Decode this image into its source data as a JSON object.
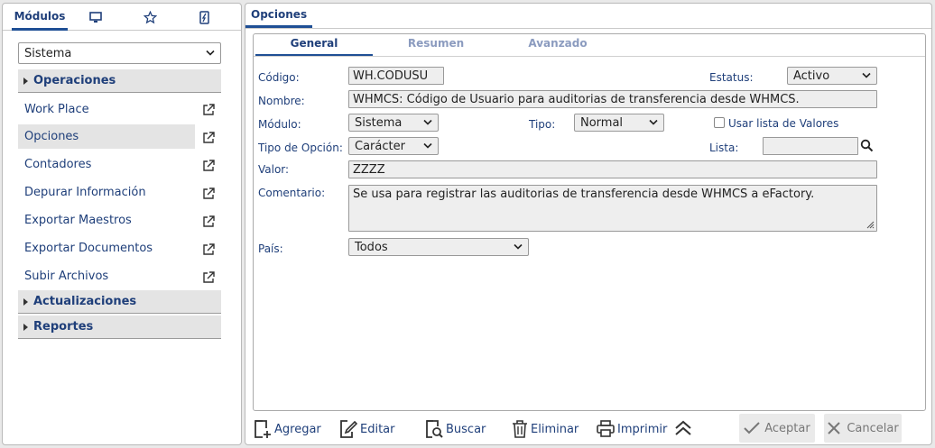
{
  "left": {
    "tabs": [
      {
        "label": "Módulos",
        "icon": "module-tab"
      },
      {
        "label": "",
        "icon": "monitor-icon"
      },
      {
        "label": "",
        "icon": "star-icon"
      },
      {
        "label": "",
        "icon": "tools-icon"
      }
    ],
    "module_select": "Sistema",
    "groups": [
      "Operaciones",
      "Actualizaciones",
      "Reportes"
    ],
    "items": [
      "Work Place",
      "Opciones",
      "Contadores",
      "Depurar Información",
      "Exportar Maestros",
      "Exportar Documentos",
      "Subir Archivos"
    ],
    "selected_item": "Opciones"
  },
  "right": {
    "title": "Opciones",
    "tabs": [
      "General",
      "Resumen",
      "Avanzado"
    ],
    "active_tab": "General",
    "form": {
      "codigo_label": "Código:",
      "codigo": "WH.CODUSU",
      "estatus_label": "Estatus:",
      "estatus": "Activo",
      "nombre_label": "Nombre:",
      "nombre": "WHMCS: Código de Usuario para auditorias de transferencia desde WHMCS.",
      "modulo_label": "Módulo:",
      "modulo": "Sistema",
      "tipo_label": "Tipo:",
      "tipo": "Normal",
      "usar_lista_label": "Usar lista de Valores",
      "tipo_opcion_label": "Tipo de Opción:",
      "tipo_opcion": "Carácter",
      "lista_label": "Lista:",
      "lista": "",
      "valor_label": "Valor:",
      "valor": "ZZZZ",
      "comentario_label": "Comentario:",
      "comentario": "Se usa para registrar las auditorias de transferencia desde WHMCS a eFactory.",
      "pais_label": "País:",
      "pais": "Todos"
    },
    "toolbar": {
      "agregar": "Agregar",
      "editar": "Editar",
      "buscar": "Buscar",
      "eliminar": "Eliminar",
      "imprimir": "Imprimir",
      "aceptar": "Aceptar",
      "cancelar": "Cancelar"
    }
  },
  "colors": {
    "accent": "#1f4f95",
    "text": "#1f3f7a",
    "panel_bg": "#e4e4e4"
  }
}
